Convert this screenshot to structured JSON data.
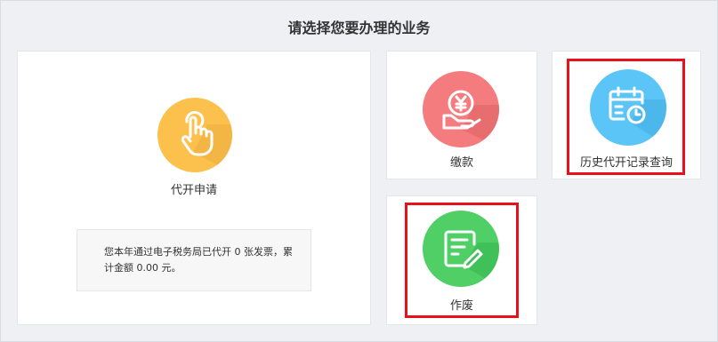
{
  "page": {
    "title": "请选择您要办理的业务"
  },
  "cards": {
    "issue": {
      "label": "代开申请",
      "icon": "hand-pointer-icon",
      "color": "#fcc14d"
    },
    "pay": {
      "label": "缴款",
      "icon": "yen-payment-icon",
      "color": "#f47c7e"
    },
    "history": {
      "label": "历史代开记录查询",
      "icon": "calendar-clock-icon",
      "color": "#5cc5f7"
    },
    "void": {
      "label": "作废",
      "icon": "edit-document-icon",
      "color": "#4fcf66"
    }
  },
  "info": {
    "text": "您本年通过电子税务局已代开 0 张发票，累计金额 0.00 元。"
  },
  "highlight_color": "#e8101a"
}
